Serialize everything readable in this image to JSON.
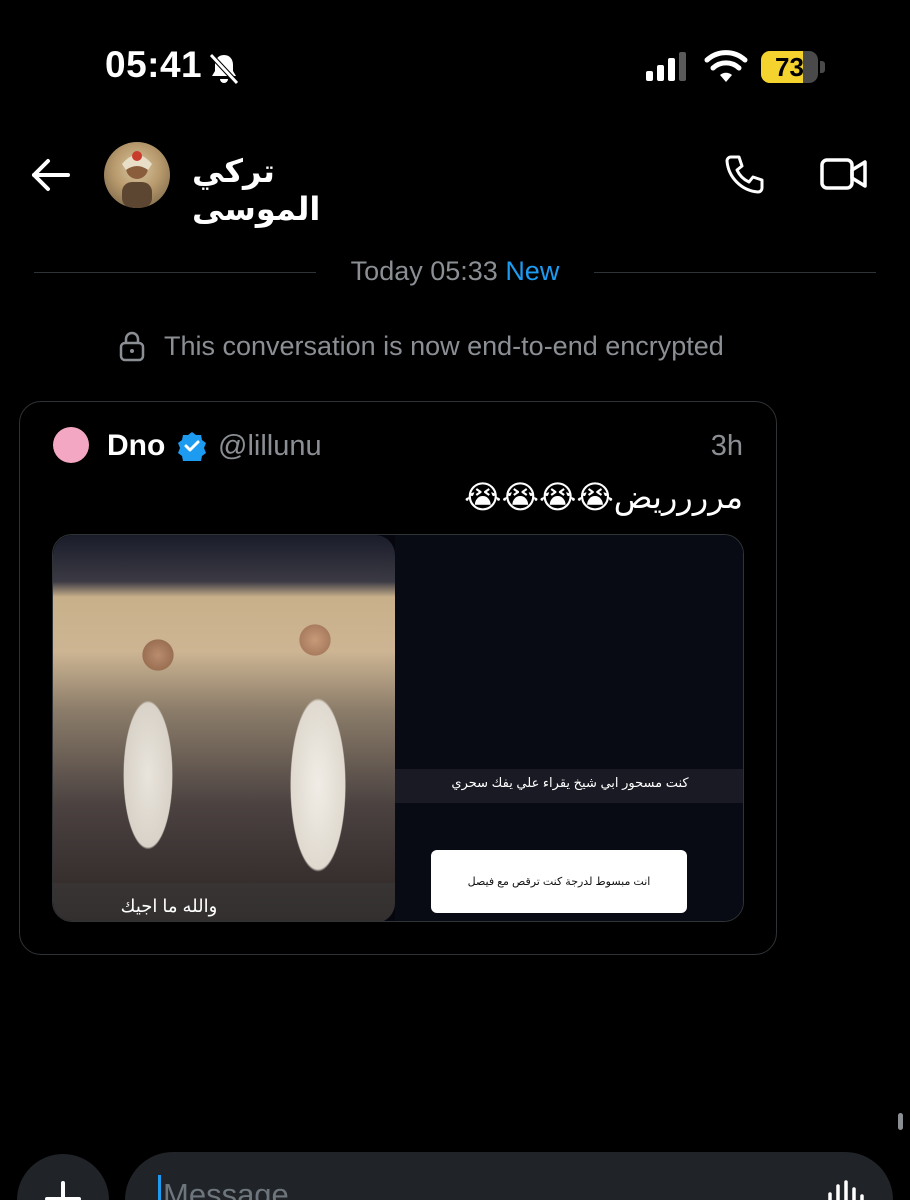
{
  "status_bar": {
    "time": "05:41",
    "battery_level": "73",
    "battery_fraction": 0.73,
    "icons": [
      "bell-slash-icon",
      "signal-icon",
      "wifi-icon",
      "battery-icon"
    ]
  },
  "header": {
    "contact_name": "تركي الموسى",
    "icons": [
      "back-arrow-icon",
      "phone-icon",
      "video-camera-icon"
    ]
  },
  "conversation": {
    "date_separator": "Today 05:33",
    "new_label": "New",
    "encryption_notice": "This conversation is now end-to-end encrypted"
  },
  "tweet": {
    "author_name": "Dno",
    "author_handle": "@lillunu",
    "time": "3h",
    "text": "مرررريض😭😭😭😭",
    "media": {
      "left_caption": "والله ما اجيك",
      "right_caption": "كنت مسحور ابي شيخ يقراء علي يفك سحري",
      "right_box_text": "انت مبسوط لدرجة كنت ترقص مع فيصل"
    },
    "colors": {
      "avatar": "#f4a7c3",
      "verified": "#1d9bf0"
    }
  },
  "composer": {
    "placeholder": "Message",
    "value": "",
    "icons": [
      "plus-icon",
      "voice-wave-icon"
    ]
  },
  "colors": {
    "background": "#000000",
    "accent": "#1d9bf0",
    "secondary_text": "#8b8f94",
    "battery": "#f5d32e"
  }
}
